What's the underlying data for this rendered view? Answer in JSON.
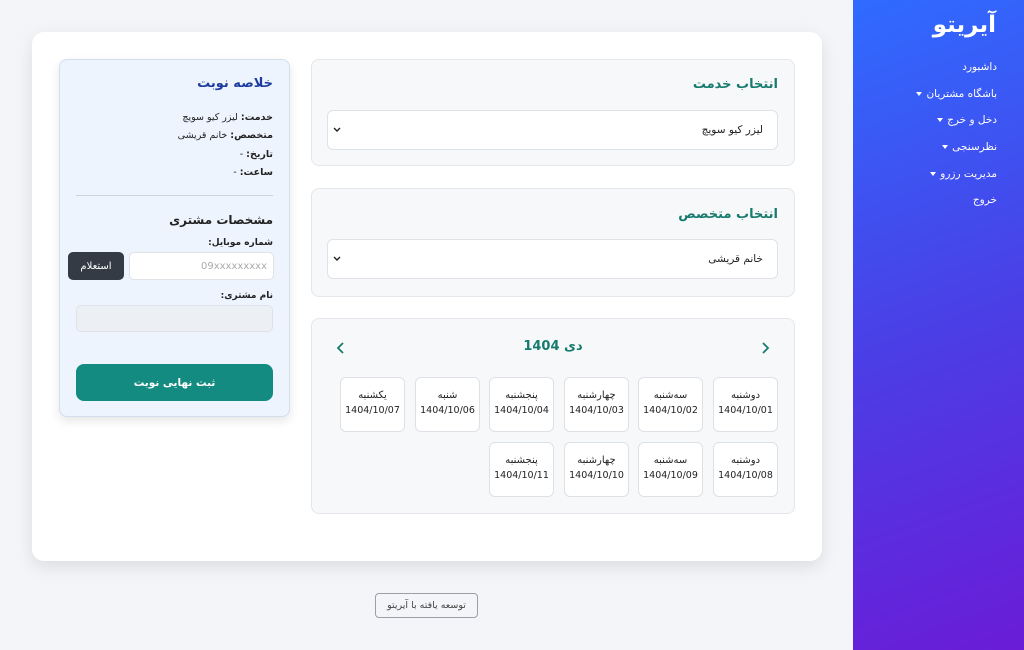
{
  "sidebar": {
    "brand": "آیریتو",
    "items": [
      {
        "label": "داشبورد",
        "caret": false
      },
      {
        "label": "باشگاه مشتریان",
        "caret": true
      },
      {
        "label": "دخل و خرج",
        "caret": true
      },
      {
        "label": "نظرسنجی",
        "caret": true
      },
      {
        "label": "مدیریت رزرو",
        "caret": true
      },
      {
        "label": "خروج",
        "caret": false
      }
    ]
  },
  "service": {
    "title": "انتخاب خدمت",
    "selected": "لیزر کیو سویچ"
  },
  "specialist": {
    "title": "انتخاب متخصص",
    "selected": "خانم قریشی"
  },
  "calendar": {
    "month_label": "دی 1404",
    "days": [
      {
        "name": "دوشنبه",
        "date": "1404/10/01"
      },
      {
        "name": "سه‌شنبه",
        "date": "1404/10/02"
      },
      {
        "name": "چهارشنبه",
        "date": "1404/10/03"
      },
      {
        "name": "پنجشنبه",
        "date": "1404/10/04"
      },
      {
        "name": "شنبه",
        "date": "1404/10/06"
      },
      {
        "name": "یکشنبه",
        "date": "1404/10/07"
      },
      {
        "name": "دوشنبه",
        "date": "1404/10/08"
      },
      {
        "name": "سه‌شنبه",
        "date": "1404/10/09"
      },
      {
        "name": "چهارشنبه",
        "date": "1404/10/10"
      },
      {
        "name": "پنجشنبه",
        "date": "1404/10/11"
      }
    ]
  },
  "summary": {
    "title": "خلاصه نوبت",
    "service_label": "خدمت:",
    "service_value": "لیزر کیو سویچ",
    "specialist_label": "متخصص:",
    "specialist_value": "خانم قریشی",
    "date_label": "تاریخ:",
    "date_value": "-",
    "time_label": "ساعت:",
    "time_value": "-"
  },
  "customer": {
    "title": "مشخصات مشتری",
    "mobile_label": "شماره موبایل:",
    "mobile_placeholder": "09xxxxxxxxx",
    "inquire_label": "استعلام",
    "name_label": "نام مشتری:",
    "submit_label": "ثبت نهایی نوبت"
  },
  "footer": {
    "label": "توسعه یافته با آیریتو"
  },
  "colors": {
    "accent": "#167b6e",
    "button": "#138b80",
    "sidebar_start": "#2f6bff",
    "sidebar_end": "#6a1cd6",
    "summary_title": "#1d3c9e"
  }
}
